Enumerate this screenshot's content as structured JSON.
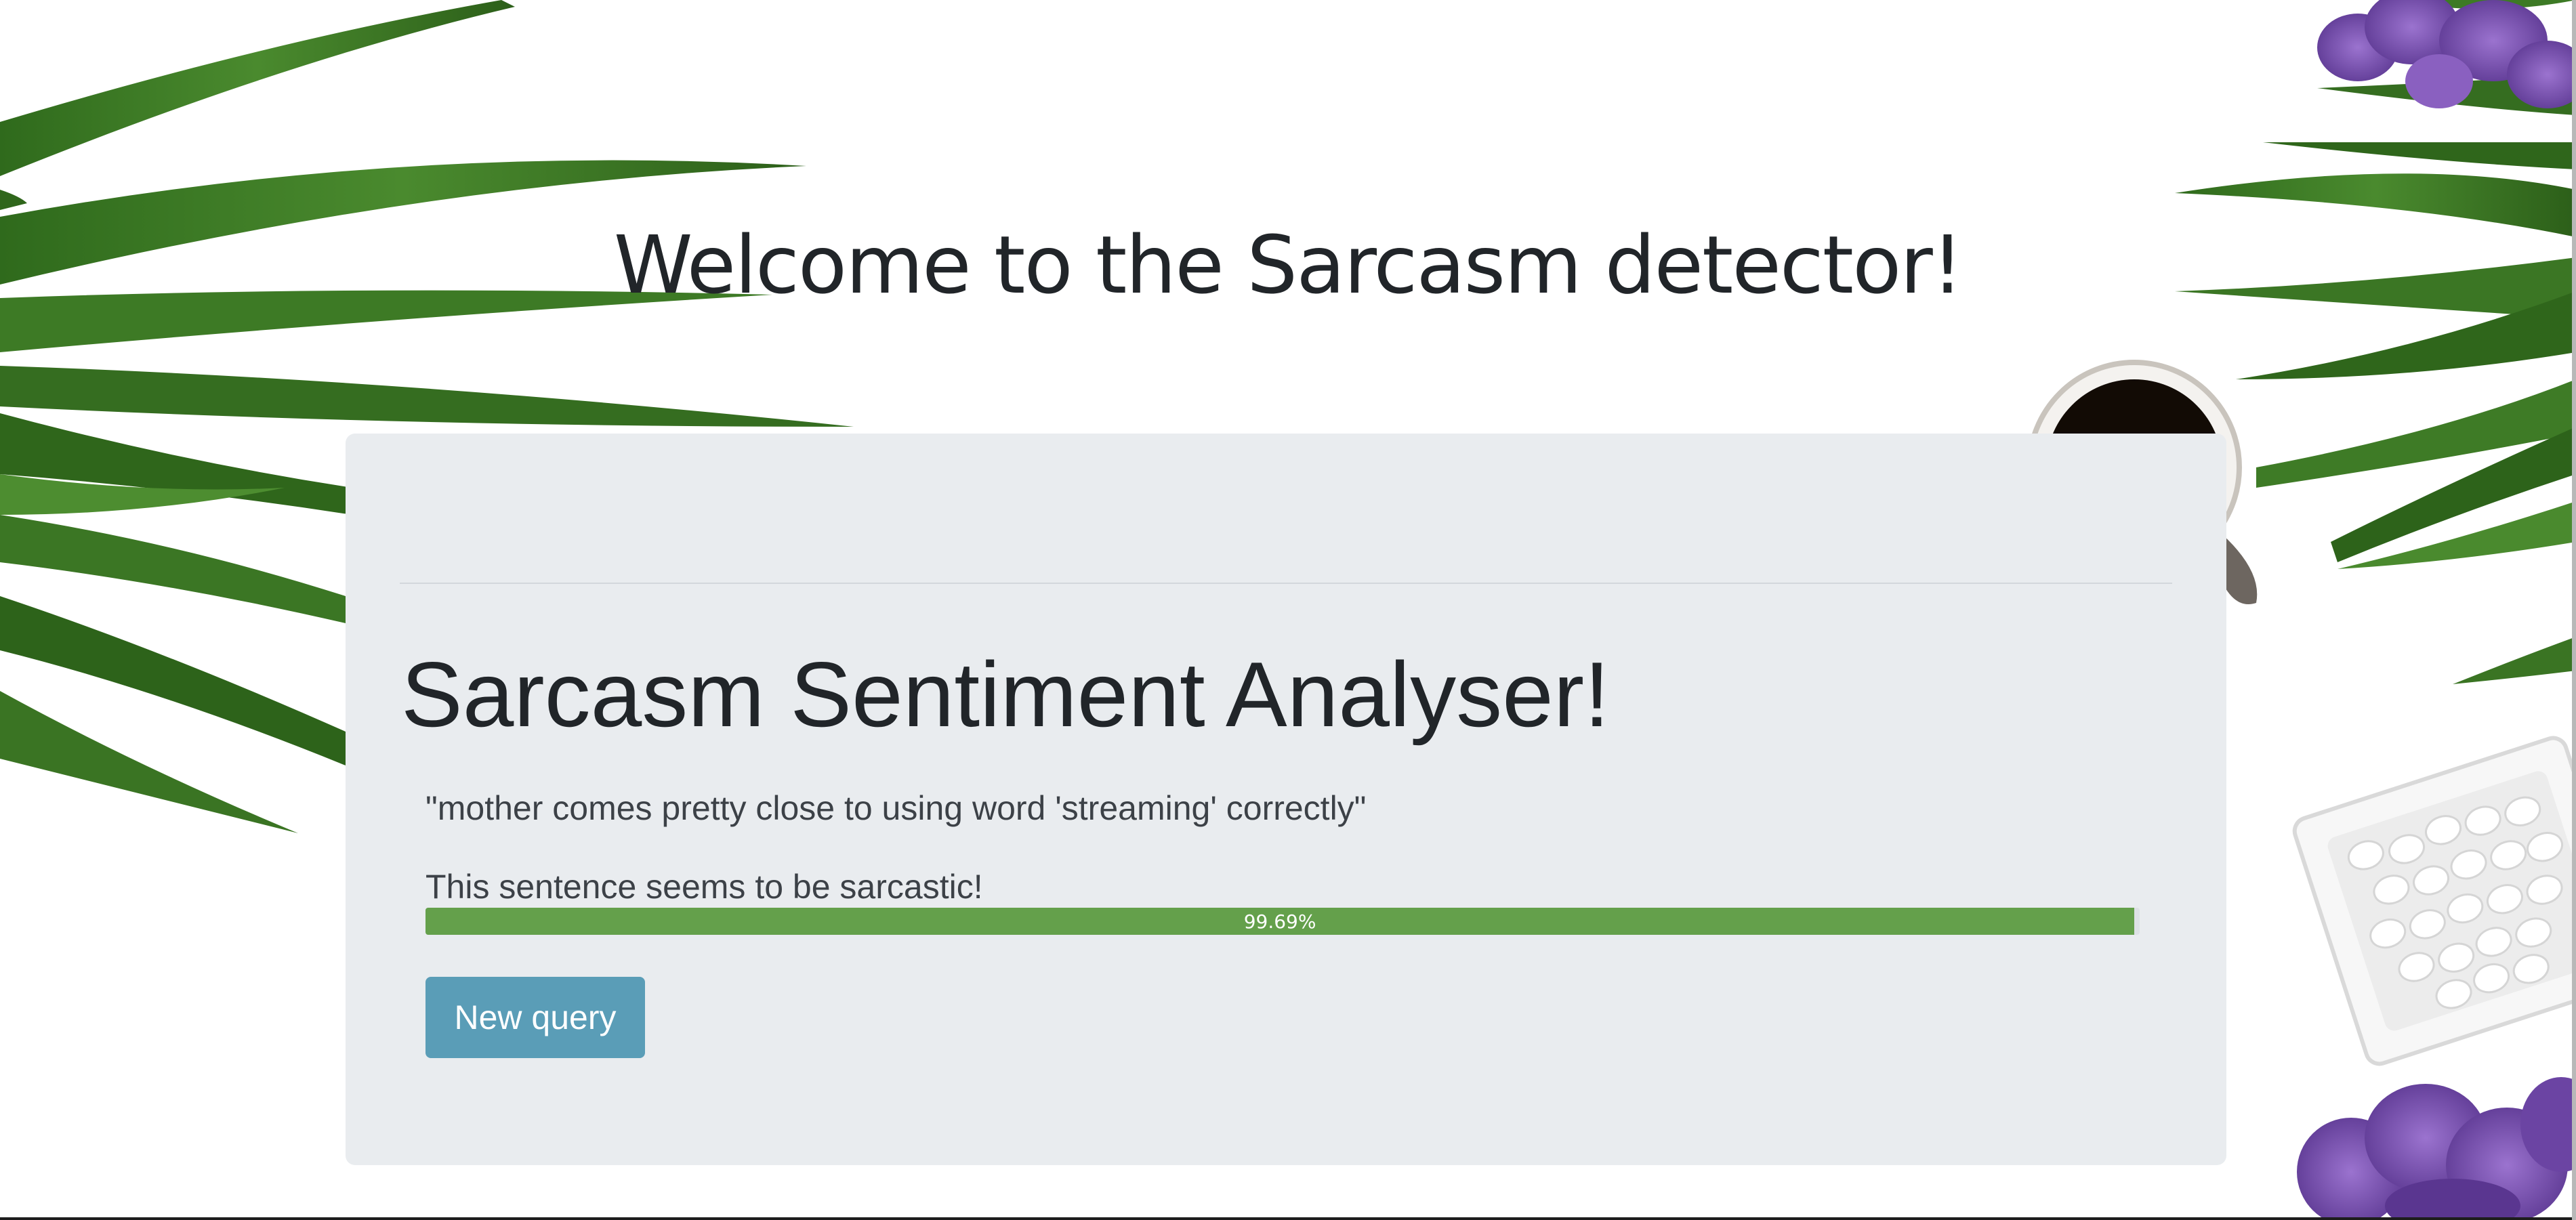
{
  "header": {
    "welcome_title": "Welcome to the Sarcasm detector!"
  },
  "analyser": {
    "title": "Sarcasm Sentiment Analyser!",
    "query_text": "\"mother comes pretty close to using word 'streaming' correctly\"",
    "verdict": "This sentence seems to be sarcastic!",
    "confidence_label": "99.69%",
    "confidence_fraction": 0.9969,
    "new_query_label": "New query"
  },
  "colors": {
    "progress_fill": "#64a04b",
    "button_bg": "#5a9db7",
    "panel_bg": "#e9ecef",
    "leaf_green": "#3f7a26",
    "flower_purple": "#7a4fb0"
  },
  "icons": {
    "background_decor": [
      "palm-leaf-icon",
      "coffee-cup-icon",
      "sugar-bowl-icon",
      "purple-flower-icon"
    ]
  }
}
